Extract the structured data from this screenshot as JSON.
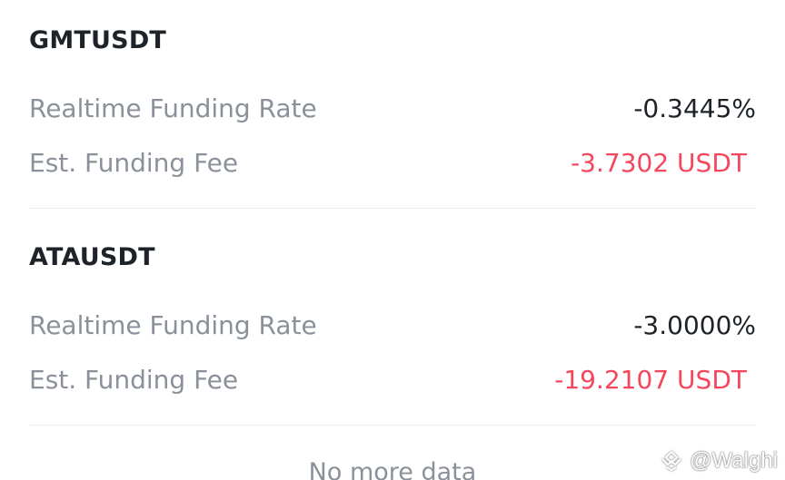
{
  "positions": [
    {
      "symbol": "GMTUSDT",
      "rate_label": "Realtime Funding Rate",
      "rate_value": "-0.3445%",
      "fee_label": "Est. Funding Fee",
      "fee_value": "-3.7302 USDT"
    },
    {
      "symbol": "ATAUSDT",
      "rate_label": "Realtime Funding Rate",
      "rate_value": "-3.0000%",
      "fee_label": "Est. Funding Fee",
      "fee_value": "-19.2107 USDT"
    }
  ],
  "footer": {
    "text": "No more data"
  },
  "watermark": {
    "text": "@Walghi",
    "icon": "binance-square-logo"
  },
  "colors": {
    "primary_text": "#1e2329",
    "secondary_text": "#8a919b",
    "negative": "#f6465d",
    "divider": "#eaecef"
  }
}
